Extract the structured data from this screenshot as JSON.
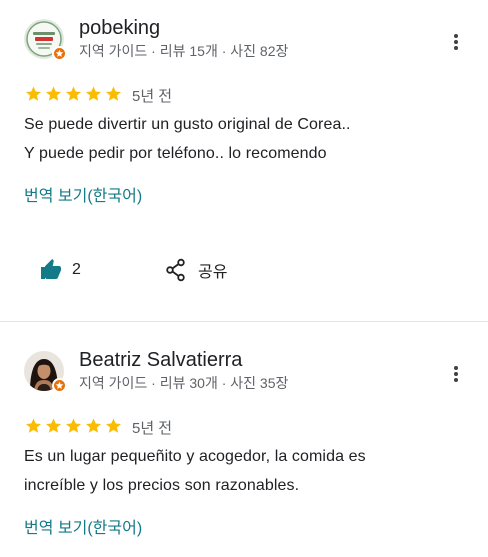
{
  "colors": {
    "star": "#fbbc04",
    "link": "#137a87",
    "badge": "#e8710a",
    "like_icon": "#137a87",
    "meta_text": "#5f6368"
  },
  "reviews": [
    {
      "author": "pobeking",
      "meta": "지역 가이드 · 리뷰 15개 · 사진 82장",
      "rating": 5,
      "time": "5년 전",
      "text_lines": [
        "Se puede divertir un gusto original de Corea..",
        "Y puede pedir por teléfono.. lo recomendo"
      ],
      "translate_label": "번역 보기(한국어)",
      "like_count": "2",
      "share_label": "공유",
      "avatar_icon": "logo-avatar-icon"
    },
    {
      "author": "Beatriz Salvatierra",
      "meta": "지역 가이드 · 리뷰 30개 · 사진 35장",
      "rating": 5,
      "time": "5년 전",
      "text_lines": [
        "Es un lugar pequeñito y acogedor, la comida es",
        "increíble y los precios son razonables."
      ],
      "translate_label": "번역 보기(한국어)",
      "avatar_icon": "person-avatar-icon"
    }
  ]
}
